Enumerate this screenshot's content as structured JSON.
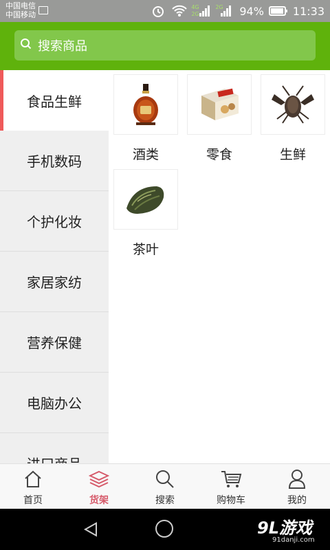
{
  "status_bar": {
    "carrier1": "中国电信",
    "carrier2": "中国移动",
    "net_4g": "4G",
    "net_2g": "2G",
    "net_2g_b": "2G",
    "battery": "94%",
    "time": "11:33"
  },
  "search": {
    "placeholder": "搜索商品"
  },
  "sidebar": {
    "items": [
      {
        "label": "食品生鲜",
        "active": true
      },
      {
        "label": "手机数码"
      },
      {
        "label": "个护化妆"
      },
      {
        "label": "家居家纺"
      },
      {
        "label": "营养保健"
      },
      {
        "label": "电脑办公"
      },
      {
        "label": "进口商品"
      }
    ]
  },
  "products": [
    {
      "label": "酒类",
      "icon": "liquor-bottle-image"
    },
    {
      "label": "零食",
      "icon": "snack-box-image"
    },
    {
      "label": "生鲜",
      "icon": "lobster-image"
    },
    {
      "label": "茶叶",
      "icon": "tea-leaves-image"
    }
  ],
  "tabs": [
    {
      "label": "首页",
      "icon": "home-icon"
    },
    {
      "label": "货架",
      "icon": "shelf-icon",
      "active": true
    },
    {
      "label": "搜索",
      "icon": "search-icon"
    },
    {
      "label": "购物车",
      "icon": "cart-icon"
    },
    {
      "label": "我的",
      "icon": "user-icon"
    }
  ],
  "watermark": {
    "brand": "9L游戏",
    "site": "91danji.com"
  },
  "colors": {
    "header": "#5fb20c",
    "accent": "#ef5a5a",
    "active_tab": "#d65a6a"
  }
}
